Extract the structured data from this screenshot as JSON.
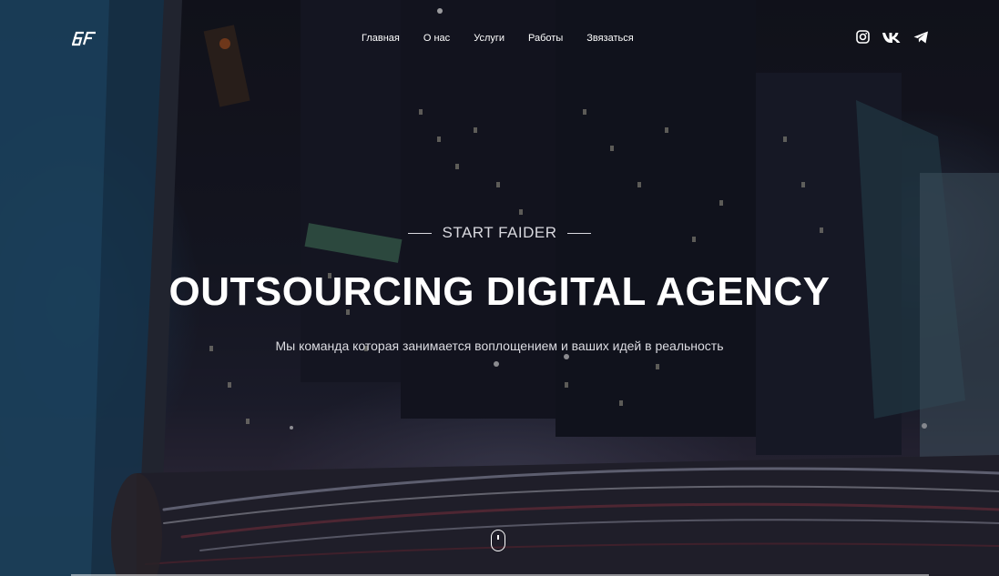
{
  "header": {
    "logo_text": "SF",
    "nav": [
      {
        "label": "Главная"
      },
      {
        "label": "О нас"
      },
      {
        "label": "Услуги"
      },
      {
        "label": "Работы"
      },
      {
        "label": "Звязаться"
      }
    ],
    "social": [
      {
        "icon": "instagram-icon"
      },
      {
        "icon": "vk-icon"
      },
      {
        "icon": "telegram-icon"
      }
    ]
  },
  "hero": {
    "eyebrow": "START FAIDER",
    "headline": "OUTSOURCING DIGITAL AGENCY",
    "subline": "Мы команда которая занимается воплощением и ваших идей в реальность",
    "scroll_icon": "mouse-icon"
  },
  "colors": {
    "text": "#ffffff",
    "muted_text": "#dcdce2",
    "background": "#14151d"
  }
}
